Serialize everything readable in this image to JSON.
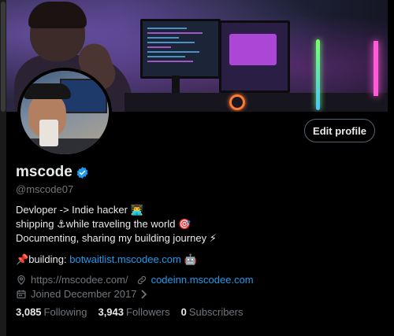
{
  "colors": {
    "background": "#000000",
    "text": "#e7e9ea",
    "muted": "#71767b",
    "link": "#1d9bf0",
    "verified": "#1d9bf0"
  },
  "header": {
    "edit_profile_label": "Edit profile"
  },
  "profile": {
    "display_name": "mscode",
    "handle": "@mscode07",
    "verified_icon": "verified-badge-icon"
  },
  "bio": {
    "line1_text": "Devloper -> Indie hacker ",
    "line1_emoji": "👨‍💻",
    "line2_text1": "shipping ",
    "line2_emoji1": "⚓",
    "line2_text2": "while traveling the world ",
    "line2_emoji2": "🎯",
    "line3_text": "Documenting, sharing my building journey ",
    "line3_emoji": "⚡",
    "building_emoji": "📌",
    "building_label": "building: ",
    "building_link": "botwaitlist.mscodee.com",
    "building_trailing_emoji": "🤖"
  },
  "meta": {
    "location_icon": "location-pin-icon",
    "website_text": "https://mscodee.com/",
    "link_icon": "link-icon",
    "link_text": "codeinn.mscodee.com",
    "calendar_icon": "calendar-icon",
    "joined_text": "Joined December 2017",
    "chevron_icon": "chevron-right-icon"
  },
  "stats": {
    "following_count": "3,085",
    "following_label": "Following",
    "followers_count": "3,943",
    "followers_label": "Followers",
    "subscribers_count": "0",
    "subscribers_label": "Subscribers"
  }
}
